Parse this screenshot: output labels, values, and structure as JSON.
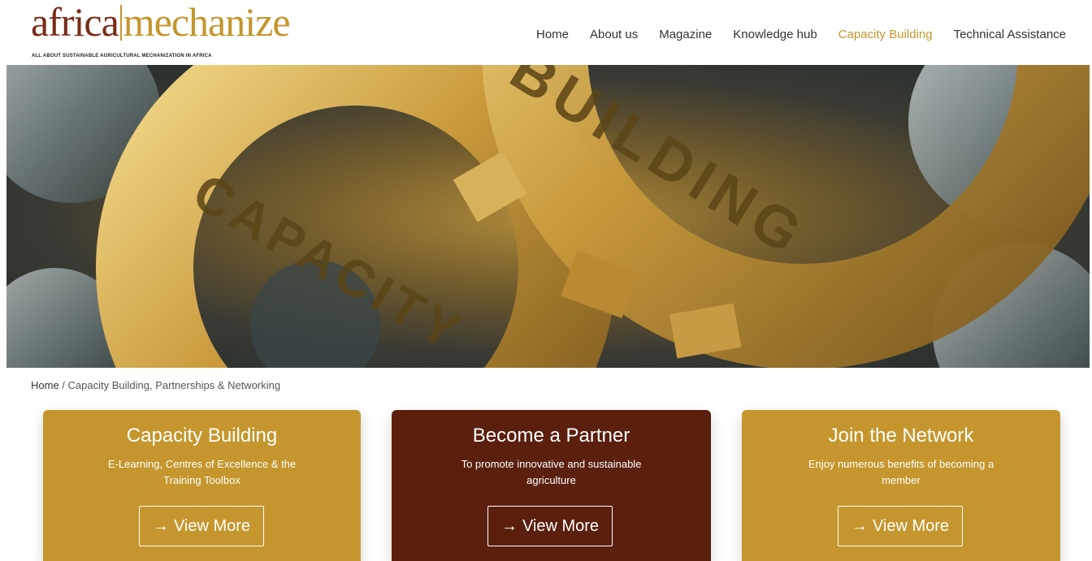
{
  "logo": {
    "word_africa": "africa",
    "word_mechanize": "mechanize",
    "tagline": "ALL ABOUT SUSTAINABLE AGRICULTURAL MECHANIZATION IN AFRICA"
  },
  "nav": {
    "items": [
      {
        "label": "Home"
      },
      {
        "label": "About us"
      },
      {
        "label": "Magazine"
      },
      {
        "label": "Knowledge hub"
      },
      {
        "label": "Capacity Building"
      },
      {
        "label": "Technical Assistance"
      }
    ],
    "active_color": "#c4962d"
  },
  "hero": {
    "word_top": "BUILDING",
    "word_bottom": "CAPACITY"
  },
  "breadcrumb": {
    "home": "Home",
    "separator": " / ",
    "current": "Capacity Building, Partnerships & Networking"
  },
  "cards": [
    {
      "title": "Capacity Building",
      "subtitle": "E-Learning, Centres of Excellence & the Training Toolbox",
      "button": "View More",
      "arrow": "→",
      "color": "#c4962d"
    },
    {
      "title": "Become a Partner",
      "subtitle": "To promote innovative and sustainable agriculture",
      "button": "View More",
      "arrow": "→",
      "color": "#5a1f0d"
    },
    {
      "title": "Join the Network",
      "subtitle": "Enjoy numerous benefits of becoming a member",
      "button": "View More",
      "arrow": "→",
      "color": "#c4962d"
    }
  ]
}
